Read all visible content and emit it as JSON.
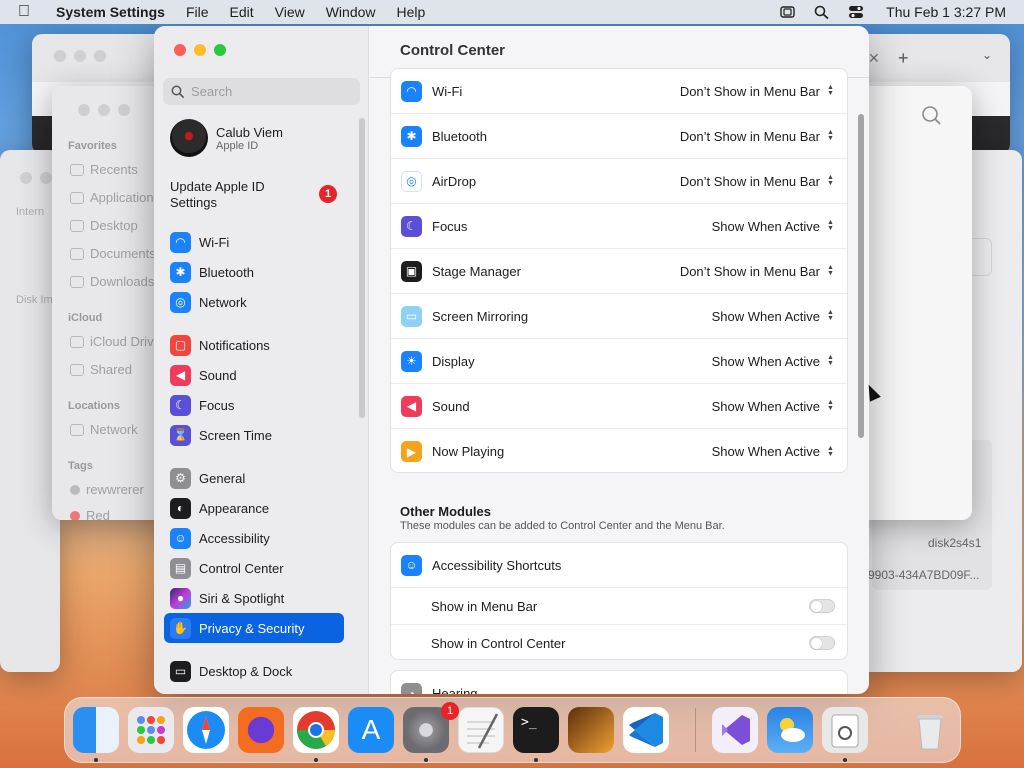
{
  "menubar": {
    "app": "System Settings",
    "items": [
      "File",
      "Edit",
      "View",
      "Window",
      "Help"
    ],
    "clock": "Thu Feb 1  3:27 PM"
  },
  "finder": {
    "sections": [
      {
        "head": "Favorites",
        "items": [
          "Recents",
          "Applications",
          "Desktop",
          "Documents",
          "Downloads"
        ]
      },
      {
        "head": "iCloud",
        "items": [
          "iCloud Drive",
          "Shared"
        ]
      },
      {
        "head": "Locations",
        "items": [
          "Network"
        ]
      },
      {
        "head": "Tags",
        "items": [
          "rewwrerer",
          "Red"
        ]
      }
    ],
    "behind_labels": [
      "Intern",
      "Disk Im"
    ],
    "right_labels": [
      "disk2s4s1",
      "9903-434A7BD09F..."
    ]
  },
  "settings": {
    "search_placeholder": "Search",
    "user": {
      "name": "Calub Viem",
      "sub": "Apple ID"
    },
    "update": {
      "label": "Update Apple ID Settings",
      "badge": "1"
    },
    "sidebar": [
      {
        "label": "Wi-Fi",
        "icon": "wifi-icon",
        "color": "#1a82fb"
      },
      {
        "label": "Bluetooth",
        "icon": "bluetooth-icon",
        "color": "#1a82fb"
      },
      {
        "label": "Network",
        "icon": "globe-icon",
        "color": "#1a82fb"
      },
      {
        "label": "Notifications",
        "icon": "bell-icon",
        "color": "#f2453d"
      },
      {
        "label": "Sound",
        "icon": "speaker-icon",
        "color": "#ef3c5c"
      },
      {
        "label": "Focus",
        "icon": "moon-icon",
        "color": "#5b4fd8"
      },
      {
        "label": "Screen Time",
        "icon": "hourglass-icon",
        "color": "#5b4fd8"
      },
      {
        "label": "General",
        "icon": "gear-icon",
        "color": "#8e8e93"
      },
      {
        "label": "Appearance",
        "icon": "appearance-icon",
        "color": "#1d1d1f"
      },
      {
        "label": "Accessibility",
        "icon": "accessibility-icon",
        "color": "#1a82fb"
      },
      {
        "label": "Control Center",
        "icon": "control-center-icon",
        "color": "#8e8e93"
      },
      {
        "label": "Siri & Spotlight",
        "icon": "siri-icon",
        "color": "#6a3bd2"
      },
      {
        "label": "Privacy & Security",
        "icon": "hand-icon",
        "color": "#2b7cf0"
      },
      {
        "label": "Desktop & Dock",
        "icon": "dock-icon",
        "color": "#1d1d1f"
      }
    ],
    "content": {
      "title": "Control Center",
      "modules": [
        {
          "label": "Wi-Fi",
          "value": "Don’t Show in Menu Bar",
          "icon": "wifi-icon",
          "color": "#1a82fb"
        },
        {
          "label": "Bluetooth",
          "value": "Don’t Show in Menu Bar",
          "icon": "bluetooth-icon",
          "color": "#1a82fb"
        },
        {
          "label": "AirDrop",
          "value": "Don’t Show in Menu Bar",
          "icon": "airdrop-icon",
          "color": "#1a82fb"
        },
        {
          "label": "Focus",
          "value": "Show When Active",
          "icon": "moon-icon",
          "color": "#5b4fd8"
        },
        {
          "label": "Stage Manager",
          "value": "Don’t Show in Menu Bar",
          "icon": "stage-manager-icon",
          "color": "#1d1d1f"
        },
        {
          "label": "Screen Mirroring",
          "value": "Show When Active",
          "icon": "screen-mirroring-icon",
          "color": "#55b6f2"
        },
        {
          "label": "Display",
          "value": "Show When Active",
          "icon": "sun-icon",
          "color": "#1a82fb"
        },
        {
          "label": "Sound",
          "value": "Show When Active",
          "icon": "speaker-icon",
          "color": "#ef3c5c"
        },
        {
          "label": "Now Playing",
          "value": "Show When Active",
          "icon": "play-icon",
          "color": "#f7a21b"
        }
      ],
      "other": {
        "title": "Other Modules",
        "subtitle": "These modules can be added to Control Center and the Menu Bar.",
        "accessibility": "Accessibility Shortcuts",
        "show_menu_bar": "Show in Menu Bar",
        "show_control_center": "Show in Control Center",
        "hearing": "Hearing"
      }
    }
  },
  "dock": {
    "apps": [
      {
        "name": "Finder",
        "color": "#2a8ff0"
      },
      {
        "name": "Launchpad",
        "color": "#e9e9ee"
      },
      {
        "name": "Safari",
        "color": "#2a8ff0"
      },
      {
        "name": "Firefox",
        "color": "#f36c21"
      },
      {
        "name": "Chrome",
        "color": "#ffffff"
      },
      {
        "name": "App Store",
        "color": "#1b8cf5"
      },
      {
        "name": "System Settings",
        "color": "#8e8e93",
        "badge": "1"
      },
      {
        "name": "TextEdit",
        "color": "#f5f5f5"
      },
      {
        "name": "Terminal",
        "color": "#1c1c1c"
      },
      {
        "name": "GarageBand",
        "color": "#f0a033"
      },
      {
        "name": "VS Code",
        "color": "#ffffff"
      },
      {
        "name": "Visual Studio",
        "color": "#f2eefa"
      },
      {
        "name": "Weather",
        "color": "#2a82e4"
      },
      {
        "name": "Disk Utility",
        "color": "#e8e8e8"
      },
      {
        "name": "Trash",
        "color": "#e8eaec"
      }
    ]
  }
}
